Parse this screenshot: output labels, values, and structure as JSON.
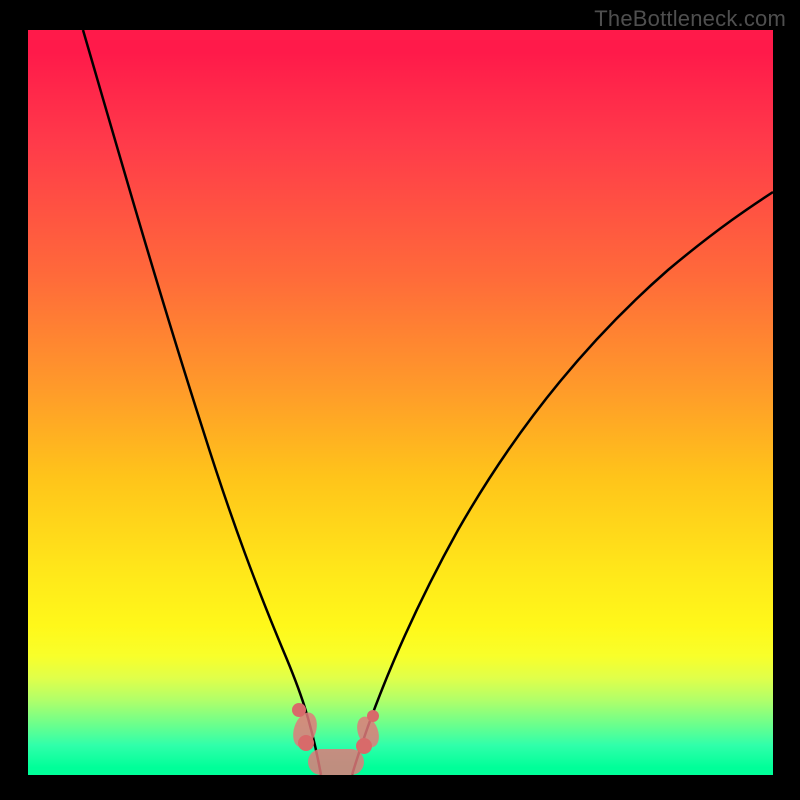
{
  "watermark": "TheBottleneck.com",
  "colors": {
    "background": "#000000",
    "watermark": "#4f4f4f",
    "curve": "#000000",
    "blob": "#e07a7a",
    "gradient_top": "#ff1a4a",
    "gradient_bottom": "#00ff99"
  },
  "chart_data": {
    "type": "line",
    "title": "",
    "xlabel": "",
    "ylabel": "",
    "xlim": [
      0,
      100
    ],
    "ylim": [
      0,
      100
    ],
    "grid": false,
    "legend": false,
    "series": [
      {
        "name": "left_curve",
        "x": [
          7,
          10,
          14,
          18,
          22,
          25,
          28,
          30,
          33,
          35,
          37,
          39
        ],
        "y": [
          100,
          90,
          78,
          64,
          50,
          38,
          27,
          20,
          12,
          7,
          3,
          0
        ]
      },
      {
        "name": "right_curve",
        "x": [
          43,
          46,
          50,
          55,
          60,
          66,
          73,
          80,
          88,
          96,
          100
        ],
        "y": [
          0,
          5,
          12,
          22,
          32,
          42,
          53,
          61,
          69,
          76,
          79
        ]
      }
    ],
    "annotations": [
      {
        "name": "highlighted_valley",
        "shape": "rounded_band",
        "x_range": [
          35,
          46
        ],
        "y_range": [
          0,
          10
        ],
        "color": "#e07a7a"
      }
    ]
  }
}
